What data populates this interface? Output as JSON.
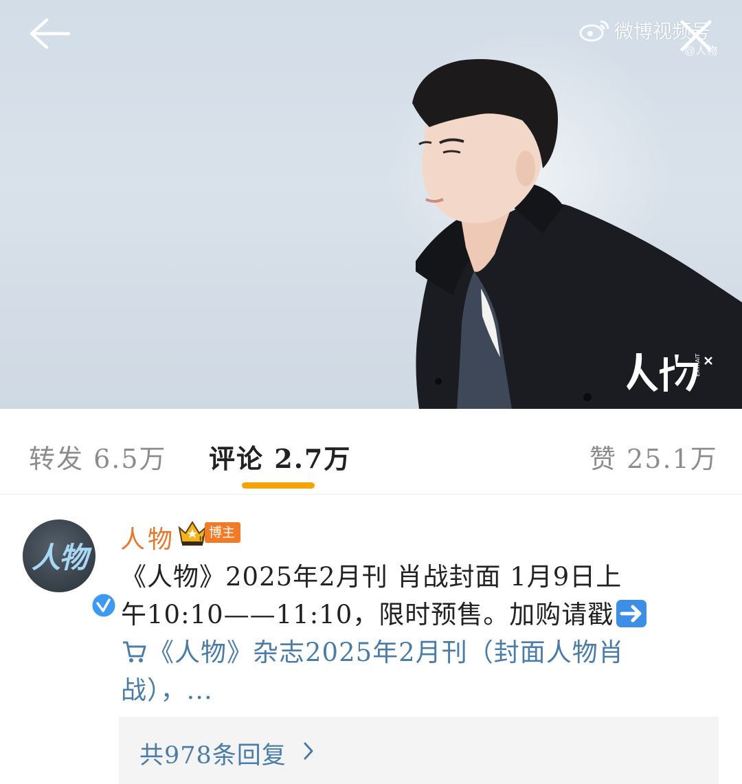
{
  "hero": {
    "watermark": "微博视频号",
    "watermark_sub": "@人物",
    "brand_logo": "人物",
    "brand_logo_sub": "EXTRAIT"
  },
  "icons": {
    "back": "arrow-left-icon",
    "close": "close-icon",
    "weibo": "weibo-logo-icon",
    "crown": "crown-icon",
    "verified": "verified-check-icon",
    "arrow_emoji": "right-arrow-emoji-icon",
    "cart": "shopping-cart-icon",
    "chevron": "chevron-right-icon"
  },
  "tabs": [
    {
      "label": "转发",
      "count": "6.5万"
    },
    {
      "label": "评论",
      "count": "2.7万",
      "active": true
    },
    {
      "label": "赞",
      "count": "25.1万"
    }
  ],
  "comment": {
    "avatar_text": "人物",
    "username": "人物",
    "badge": "博主",
    "text_line1": "《人物》2025年2月刊 肖战封面 1月9日上",
    "text_line2": "午10:10——11:10，限时预售。加购请戳",
    "link_line1": "《人物》杂志2025年2月刊（封面人物肖",
    "link_line2": "战），...",
    "replies": "共978条回复"
  },
  "colors": {
    "accent": "#f5a300",
    "username": "#e8782c",
    "link": "#4a7ca8",
    "badge_bg": "#f27b27"
  }
}
